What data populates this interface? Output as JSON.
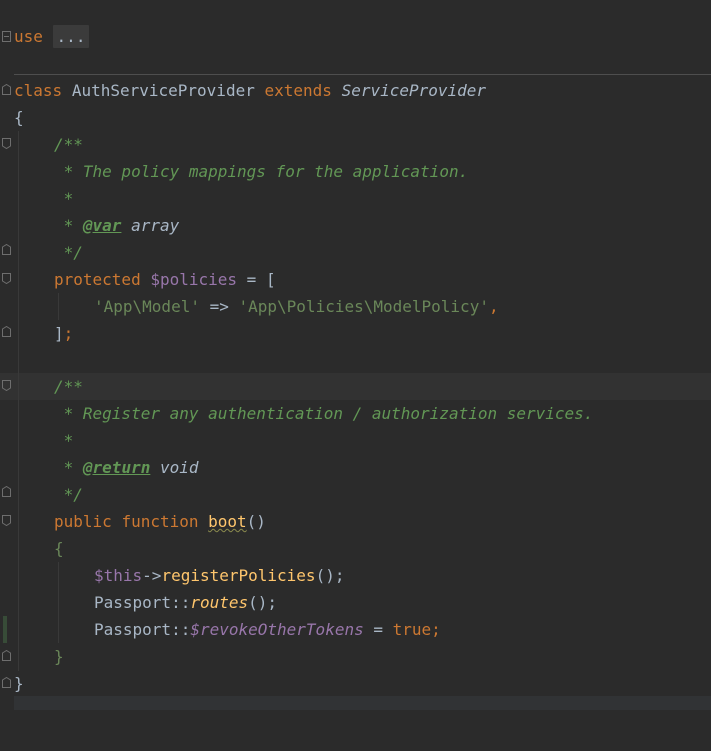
{
  "editor": {
    "lines": {
      "use_kw": "use",
      "use_fold": "...",
      "class_kw": "class",
      "class_name": "AuthServiceProvider",
      "extends_kw": "extends",
      "parent_class": "ServiceProvider",
      "open_brace": "{",
      "doc1_open": "/**",
      "doc1_desc": " * The policy mappings for the application.",
      "doc1_blank": " *",
      "doc1_star": " * ",
      "doc1_tag": "@var",
      "doc1_type": " array",
      "doc1_close": " */",
      "prop_kw": "protected",
      "prop_var": "$policies",
      "prop_assign": " = [",
      "map_key": "'App\\Model'",
      "map_arrow": " => ",
      "map_value": "'App\\Policies\\ModelPolicy'",
      "map_comma": ",",
      "arr_close": "]",
      "arr_semicolon": ";",
      "doc2_open": "/**",
      "doc2_desc": " * Register any authentication / authorization services.",
      "doc2_blank": " *",
      "doc2_star": " * ",
      "doc2_tag": "@return",
      "doc2_type": " void",
      "doc2_close": " */",
      "method_vis": "public",
      "method_fn": "function",
      "method_name": "boot",
      "method_parens": "()",
      "method_open": "{",
      "stmt1_this": "$this",
      "stmt1_arrow": "->",
      "stmt1_call": "registerPolicies",
      "stmt1_tail": "();",
      "stmt2_class": "Passport",
      "stmt2_sep": "::",
      "stmt2_call": "routes",
      "stmt2_tail": "();",
      "stmt3_class": "Passport",
      "stmt3_sep": "::",
      "stmt3_var": "$revokeOtherTokens",
      "stmt3_assign": " = ",
      "stmt3_value": "true",
      "stmt3_semicolon": ";",
      "method_close": "}",
      "class_close": "}"
    }
  },
  "colors": {
    "background": "#2b2b2b",
    "keyword": "#cc7832",
    "doc_comment": "#629755",
    "variable": "#9876aa",
    "string": "#6a8759",
    "function": "#ffc66d",
    "text": "#a9b7c6"
  }
}
